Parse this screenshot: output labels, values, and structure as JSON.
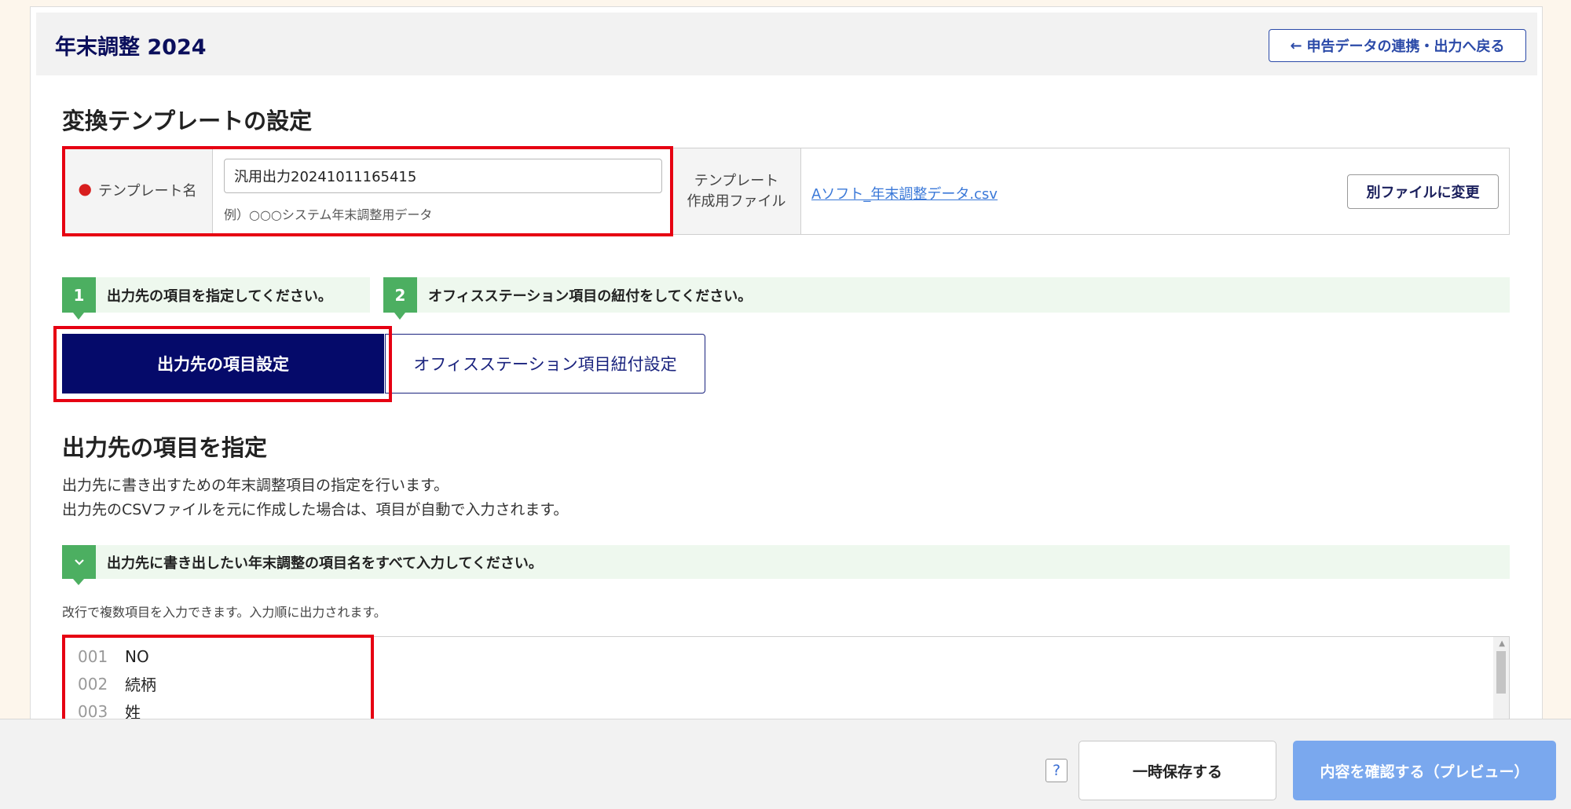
{
  "header": {
    "title": "年末調整 2024",
    "back_button": "申告データの連携・出力へ戻る",
    "back_icon": "←"
  },
  "section": {
    "title": "変換テンプレートの設定"
  },
  "template": {
    "name_label": "テンプレート名",
    "name_value": "汎用出力20241011165415",
    "name_example": "例）○○○システム年末調整用データ",
    "file_label": "テンプレート\n作成用ファイル",
    "file_label_line1": "テンプレート",
    "file_label_line2": "作成用ファイル",
    "file_name": "Aソフト_年末調整データ.csv",
    "change_file_button": "別ファイルに変更"
  },
  "steps": [
    {
      "num": "1",
      "label": "出力先の項目を指定してください。"
    },
    {
      "num": "2",
      "label": "オフィスステーション項目の紐付をしてください。"
    }
  ],
  "tabs": {
    "active": "出力先の項目設定",
    "inactive": "オフィスステーション項目紐付設定"
  },
  "output_items": {
    "title": "出力先の項目を指定",
    "desc_line1": "出力先に書き出すための年末調整項目の指定を行います。",
    "desc_line2": "出力先のCSVファイルを元に作成した場合は、項目が自動で入力されます。",
    "instruction": "出力先に書き出したい年末調整の項目名をすべて入力してください。",
    "hint": "改行で複数項目を入力できます。入力順に出力されます。",
    "lines": [
      {
        "num": "001",
        "value": "NO"
      },
      {
        "num": "002",
        "value": "続柄"
      },
      {
        "num": "003",
        "value": "姓"
      }
    ]
  },
  "footer": {
    "help": "?",
    "save_button": "一時保存する",
    "confirm_button": "内容を確認する（プレビュー）"
  },
  "colors": {
    "brand_navy": "#050a6a",
    "step_green": "#4caf61",
    "highlight_red": "#e60012",
    "confirm_blue": "#7aa8ee",
    "link_blue": "#3a78d8"
  }
}
